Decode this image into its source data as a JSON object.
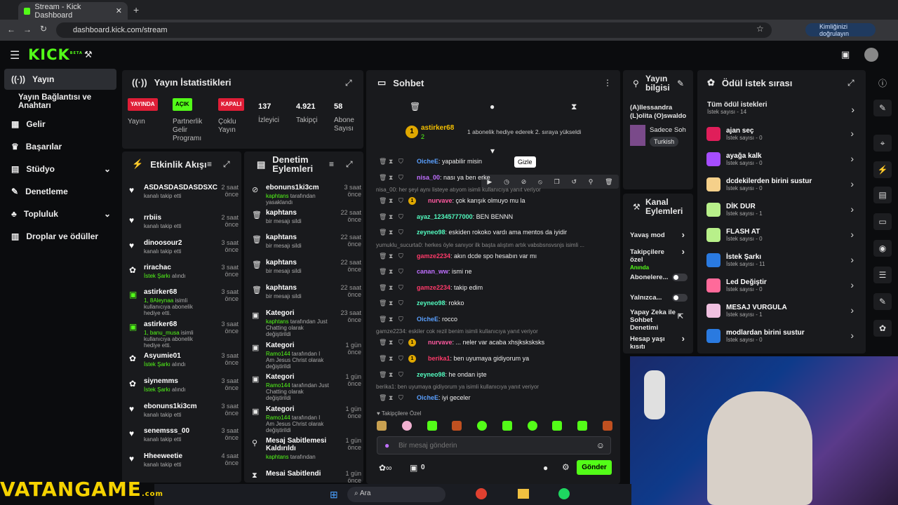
{
  "browser": {
    "tab_title": "Stream - Kick Dashboard",
    "url": "dashboard.kick.com/stream",
    "verify_label": "Kimliğinizi doğrulayın"
  },
  "logo": "KICK",
  "logo_tag": "BETA",
  "sidebar": {
    "items": [
      {
        "label": "Yayın",
        "icon": "broadcast-icon"
      },
      {
        "label": "Yayın Bağlantısı ve Anahtarı"
      },
      {
        "label": "Gelir",
        "icon": "chart-icon"
      },
      {
        "label": "Başarılar",
        "icon": "trophy-icon"
      },
      {
        "label": "Stüdyo",
        "icon": "studio-icon"
      },
      {
        "label": "Denetleme",
        "icon": "wrench-icon"
      },
      {
        "label": "Topluluk",
        "icon": "community-icon"
      },
      {
        "label": "Droplar ve ödüller",
        "icon": "drops-icon"
      }
    ]
  },
  "stats": {
    "title": "Yayın İstatistikleri",
    "cells": [
      {
        "badge": "YAYINDA",
        "badge_color": "#e01e37",
        "label": "Yayın"
      },
      {
        "badge": "AÇIK",
        "badge_color": "#53fc18",
        "label": "Partnerlik Gelir Programı"
      },
      {
        "badge": "KAPALI",
        "badge_color": "#e01e37",
        "label": "Çoklu Yayın"
      },
      {
        "value": "137",
        "label": "İzleyici"
      },
      {
        "value": "4.921",
        "label": "Takipçi"
      },
      {
        "value": "58",
        "label": "Abone Sayısı"
      }
    ]
  },
  "activity": {
    "title": "Etkinlik Akışı",
    "items": [
      {
        "name": "ASDASDASDASDSXC",
        "time": "2 saat önce",
        "sub": "kanalı takip etti"
      },
      {
        "name": "rrbiis",
        "time": "2 saat önce",
        "sub": "kanalı takip etti"
      },
      {
        "name": "dinoosour2",
        "time": "3 saat önce",
        "sub": "kanalı takip etti"
      },
      {
        "name": "rirachac",
        "time": "3 saat önce",
        "sub_hl": "İstek Şarkı",
        "sub": " alındı"
      },
      {
        "name": "astirker68",
        "time": "3 saat önce",
        "sub_hl": "1, 8Aleynaa",
        "sub": " isimli kullanıcıya abonelik hediye etti."
      },
      {
        "name": "astirker68",
        "time": "3 saat önce",
        "sub_hl": "1, banu_musa",
        "sub": " isimli kullanıcıya abonelik hediye etti."
      },
      {
        "name": "Asyumie01",
        "time": "3 saat önce",
        "sub_hl": "İstek Şarkı",
        "sub": " alındı"
      },
      {
        "name": "siynemms",
        "time": "3 saat önce",
        "sub_hl": "İstek Şarkı",
        "sub": " alındı"
      },
      {
        "name": "ebonuns1ki3cm",
        "time": "3 saat önce",
        "sub": "kanalı takip etti"
      },
      {
        "name": "senemsss_00",
        "time": "3 saat önce",
        "sub": "kanalı takip etti"
      },
      {
        "name": "Hheeweetie",
        "time": "4 saat önce",
        "sub": "kanalı takip etti"
      }
    ]
  },
  "modactions": {
    "title": "Denetim Eylemleri",
    "items": [
      {
        "name": "ebonuns1ki3cm",
        "time": "3 saat önce",
        "sub_hl": "kaphtans",
        "sub": " tarafından yasaklandı"
      },
      {
        "name": "kaphtans",
        "time": "22 saat önce",
        "sub": "bir mesajı sildi"
      },
      {
        "name": "kaphtans",
        "time": "22 saat önce",
        "sub": "bir mesajı sildi"
      },
      {
        "name": "kaphtans",
        "time": "22 saat önce",
        "sub": "bir mesajı sildi"
      },
      {
        "name": "kaphtans",
        "time": "22 saat önce",
        "sub": "bir mesajı sildi"
      },
      {
        "name": "Kategori",
        "time": "23 saat önce",
        "sub_hl": "kaphtans",
        "sub": " tarafından Just Chatting olarak değiştirildi"
      },
      {
        "name": "Kategori",
        "time": "1 gün önce",
        "sub_hl": "Ramo144",
        "sub": " tarafından I Am Jesus Christ olarak değiştirildi"
      },
      {
        "name": "Kategori",
        "time": "1 gün önce",
        "sub_hl": "Ramo144",
        "sub": " tarafından Just Chatting olarak değiştirildi"
      },
      {
        "name": "Kategori",
        "time": "1 gün önce",
        "sub_hl": "Ramo144",
        "sub": " tarafından I Am Jesus Christ olarak değiştirildi"
      },
      {
        "name": "Mesaj Sabitlemesi Kaldırıldı",
        "time": "1 gün önce",
        "sub_hl": "kaphtans",
        "sub": " tarafından"
      },
      {
        "name": "Mesai Sabitlendi",
        "time": "1 gün önce",
        "sub": ""
      }
    ]
  },
  "chat": {
    "title": "Sohbet",
    "pinned_user": "astirker68",
    "pinned_count": "2",
    "pinned_text": "1 abonelik hediye ederek 2. sıraya yükseldi",
    "tooltip": "Gizle",
    "lines": [
      {
        "user": "OicheE",
        "color": "#5aa0ff",
        "text": ": yapabilir misin"
      },
      {
        "user": "nisa_00",
        "color": "#c070ff",
        "text": ": nası ya ben erke"
      },
      {
        "reply": "nisa_00: her şeyi aynı listeye atıyom isimli kullanıcıya yanıt veriyor"
      },
      {
        "user": "nurvave",
        "color": "#ff5aa0",
        "text": ": çok karışık olmuyo mu la",
        "gift": "1"
      },
      {
        "user": "ayaz_12345777000",
        "color": "#53fcc0",
        "text": ": BEN BENNN"
      },
      {
        "user": "zeyneo98",
        "color": "#53fcc0",
        "text": ": eskiden rokoko vardı ama mentos da iyidir"
      },
      {
        "reply": "yumuklu_sucurta0: herkes öyle sanıyor ilk başta alıştım artık vabsbsnsvsnjs isimli ..."
      },
      {
        "user": "gamze2234",
        "color": "#ff3a6a",
        "text": ": akın dcde spo hesabın var mı"
      },
      {
        "user": "canan_ww",
        "color": "#c070ff",
        "text": ": ismi ne"
      },
      {
        "user": "gamze2234",
        "color": "#ff3a6a",
        "text": ": takip edim"
      },
      {
        "user": "zeyneo98",
        "color": "#53fcc0",
        "text": ": rokko"
      },
      {
        "user": "OicheE",
        "color": "#5aa0ff",
        "text": ": rocco"
      },
      {
        "reply": "gamze2234: eskiler cok rezil benim isimli kullanıcıya yanıt veriyor"
      },
      {
        "user": "nurvave",
        "color": "#ff5aa0",
        "text": ": ... neler var acaba xhsjksksksks",
        "gift": "1"
      },
      {
        "user": "berika1",
        "color": "#ff3a6a",
        "text": ": ben uyumaya gidiyorum ya",
        "gift": "1"
      },
      {
        "user": "zeyneo98",
        "color": "#53fcc0",
        "text": ": he ondan işte"
      },
      {
        "reply": "berika1: ben uyumaya gidiyorum ya isimli kullanıcıya yanıt veriyor"
      },
      {
        "user": "OicheE",
        "color": "#5aa0ff",
        "text": ": iyi geceler"
      }
    ],
    "emote_label": "Takipçilere Özel",
    "placeholder": "Bir mesaj gönderin",
    "viewers": "0",
    "send": "Gönder"
  },
  "streaminfo": {
    "title": "Yayın bilgisi",
    "stream_title": "(A)llessandra (L)olita (O)swaldo",
    "category": "Sadece Soh",
    "tag": "Turkish"
  },
  "channel": {
    "title": "Kanal Eylemleri",
    "items": [
      {
        "label": "Yavaş mod"
      },
      {
        "label": "Takipçilere özel",
        "sub": "Anında"
      },
      {
        "label": "Abonelere..."
      },
      {
        "label": "Yalnızca..."
      },
      {
        "label": "Yapay Zeka ile Sohbet Denetimi"
      },
      {
        "label": "Hesap yaşı kısıtı"
      }
    ]
  },
  "rewards": {
    "title": "Ödül istek sırası",
    "all": "Tüm ödül istekleri",
    "all_sub": "İstek sayısı - 14",
    "items": [
      {
        "label": "ajan seç",
        "sub": "İstek sayısı - 0",
        "color": "#e01e5a"
      },
      {
        "label": "ayağa kalk",
        "sub": "İstek sayısı - 0",
        "color": "#a64dff"
      },
      {
        "label": "dcdekilerden birini sustur",
        "sub": "İstek sayısı - 0",
        "color": "#f5d08a"
      },
      {
        "label": "DİK DUR",
        "sub": "İstek sayısı - 1",
        "color": "#b8f08a"
      },
      {
        "label": "FLASH AT",
        "sub": "İstek sayısı - 0",
        "color": "#b8f08a"
      },
      {
        "label": "İstek Şarkı",
        "sub": "İstek sayısı - 11",
        "color": "#2a7ae0"
      },
      {
        "label": "Led Değiştir",
        "sub": "İstek sayısı - 0",
        "color": "#ff6a9a"
      },
      {
        "label": "MESAJ VURGULA",
        "sub": "İstek sayısı - 1",
        "color": "#f0c0e0"
      },
      {
        "label": "modlardan birini sustur",
        "sub": "İstek sayısı - 0",
        "color": "#2a7ae0"
      }
    ]
  },
  "watermark": "VATANGAME",
  "watermark_sub": ".com",
  "taskbar_search": "Ara"
}
